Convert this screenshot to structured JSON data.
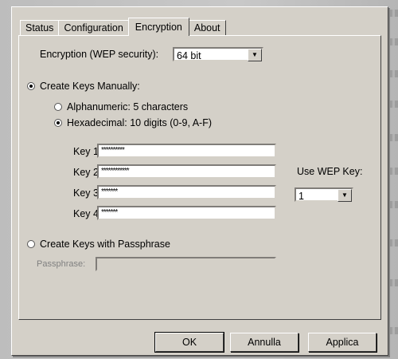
{
  "tabs": [
    {
      "label": "Status"
    },
    {
      "label": "Configuration"
    },
    {
      "label": "Encryption"
    },
    {
      "label": "About"
    }
  ],
  "encryption": {
    "label": "Encryption (WEP security):",
    "value": "64 bit"
  },
  "create_manually": {
    "label": "Create Keys Manually:",
    "alphanumeric_label": "Alphanumeric: 5 characters",
    "hexadecimal_label": "Hexadecimal: 10 digits (0-9, A-F)"
  },
  "keys": [
    {
      "label": "Key 1:",
      "value": "**********"
    },
    {
      "label": "Key 2:",
      "value": "************"
    },
    {
      "label": "Key 3:",
      "value": "*******"
    },
    {
      "label": "Key 4:",
      "value": "*******"
    }
  ],
  "use_wep_key": {
    "label": "Use WEP Key:",
    "value": "1"
  },
  "passphrase": {
    "radio_label": "Create Keys with Passphrase",
    "field_label": "Passphrase:",
    "value": ""
  },
  "buttons": {
    "ok": "OK",
    "cancel": "Annulla",
    "apply": "Applica"
  }
}
